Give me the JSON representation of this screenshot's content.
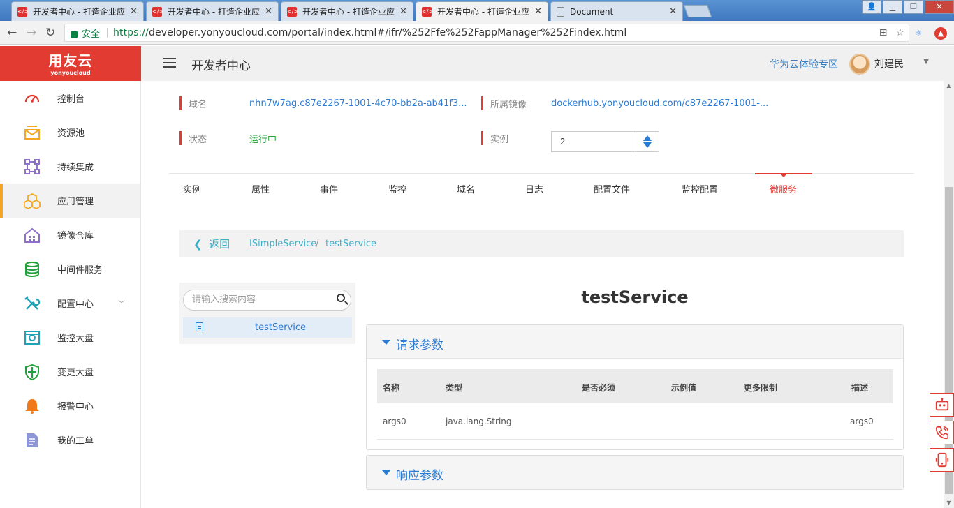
{
  "browser": {
    "tabs": [
      {
        "title": "开发者中心 - 打造企业应",
        "active": false
      },
      {
        "title": "开发者中心 - 打造企业应",
        "active": false
      },
      {
        "title": "开发者中心 - 打造企业应",
        "active": false
      },
      {
        "title": "开发者中心 - 打造企业应",
        "active": true
      },
      {
        "title": "Document",
        "active": false
      }
    ],
    "secure_label": "安全",
    "url_proto": "https://",
    "url_rest": "developer.yonyoucloud.com/portal/index.html#/ifr/%252Ffe%252FappManager%252Findex.html"
  },
  "logo": {
    "cn": "用友云",
    "en": "yonyoucloud"
  },
  "header": {
    "title": "开发者中心",
    "huawei_link": "华为云体验专区",
    "username": "刘建民"
  },
  "sidebar": {
    "items": [
      {
        "label": "控制台",
        "icon": "dashboard-icon"
      },
      {
        "label": "资源池",
        "icon": "resource-pool-icon"
      },
      {
        "label": "持续集成",
        "icon": "integration-icon"
      },
      {
        "label": "应用管理",
        "icon": "app-management-icon",
        "active": true
      },
      {
        "label": "镜像仓库",
        "icon": "image-repo-icon"
      },
      {
        "label": "中间件服务",
        "icon": "database-icon"
      },
      {
        "label": "配置中心",
        "icon": "tools-icon",
        "expandable": true
      },
      {
        "label": "监控大盘",
        "icon": "monitor-icon"
      },
      {
        "label": "变更大盘",
        "icon": "shield-icon"
      },
      {
        "label": "报警中心",
        "icon": "bell-icon"
      },
      {
        "label": "我的工单",
        "icon": "document-icon"
      }
    ]
  },
  "info": {
    "domain_key": "域名",
    "domain_val": "nhn7w7ag.c87e2267-1001-4c70-bb2a-ab41f3...",
    "image_key": "所属镜像",
    "image_val": "dockerhub.yonyoucloud.com/c87e2267-1001-...",
    "status_key": "状态",
    "status_val": "运行中",
    "instance_key": "实例",
    "instance_count": "2"
  },
  "tabs": [
    "实例",
    "属性",
    "事件",
    "监控",
    "域名",
    "日志",
    "配置文件",
    "监控配置",
    "微服务"
  ],
  "active_tab": "微服务",
  "breadcrumb": {
    "back": "返回",
    "parent": "ISimpleService",
    "current": "testService"
  },
  "left_panel": {
    "search_placeholder": "请输入搜索内容",
    "services": [
      "testService"
    ]
  },
  "service_title": "testService",
  "request_panel": {
    "title": "请求参数",
    "columns": [
      "名称",
      "类型",
      "是否必须",
      "示例值",
      "更多限制",
      "描述"
    ],
    "rows": [
      {
        "name": "args0",
        "type": "java.lang.String",
        "required": "",
        "example": "",
        "limits": "",
        "desc": "args0"
      }
    ]
  },
  "response_panel": {
    "title": "响应参数"
  },
  "colors": {
    "brand_red": "#e23b32",
    "link_blue": "#2a7bd3",
    "active_orange": "#f5a623",
    "status_green": "#23a03c"
  }
}
